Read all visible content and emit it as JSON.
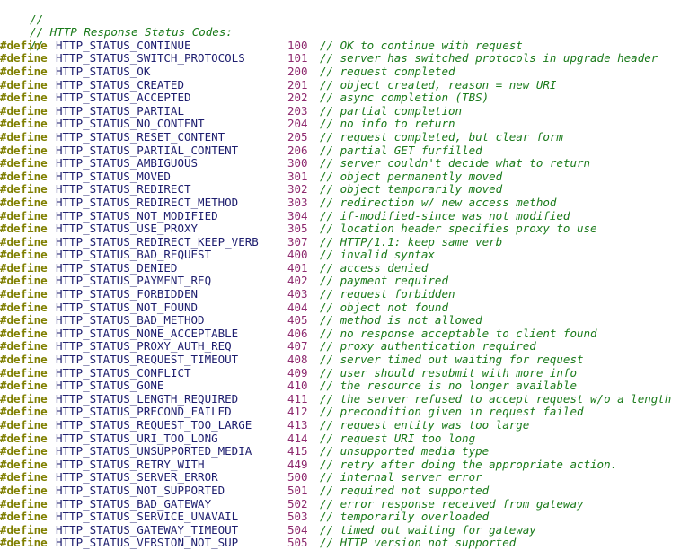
{
  "document": {
    "language": "c-header",
    "background_color": "#ffffff",
    "syntax_colors": {
      "comment": "#1a7a1a",
      "preprocessor_directive": "#7f7f00",
      "identifier": "#1d1d6e",
      "number": "#8e2a6e"
    },
    "directive_keyword": "#define",
    "comment_prefix": "//"
  },
  "header_comment": {
    "line1": "//",
    "line2": "// HTTP Response Status Codes:",
    "line3": "//"
  },
  "defines": [
    {
      "directive": "#define",
      "name": "HTTP_STATUS_CONTINUE",
      "value": "100",
      "comment": "// OK to continue with request"
    },
    {
      "directive": "#define",
      "name": "HTTP_STATUS_SWITCH_PROTOCOLS",
      "value": "101",
      "comment": "// server has switched protocols in upgrade header"
    },
    {
      "directive": "#define",
      "name": "HTTP_STATUS_OK",
      "value": "200",
      "comment": "// request completed"
    },
    {
      "directive": "#define",
      "name": "HTTP_STATUS_CREATED",
      "value": "201",
      "comment": "// object created, reason = new URI"
    },
    {
      "directive": "#define",
      "name": "HTTP_STATUS_ACCEPTED",
      "value": "202",
      "comment": "// async completion (TBS)"
    },
    {
      "directive": "#define",
      "name": "HTTP_STATUS_PARTIAL",
      "value": "203",
      "comment": "// partial completion"
    },
    {
      "directive": "#define",
      "name": "HTTP_STATUS_NO_CONTENT",
      "value": "204",
      "comment": "// no info to return"
    },
    {
      "directive": "#define",
      "name": "HTTP_STATUS_RESET_CONTENT",
      "value": "205",
      "comment": "// request completed, but clear form"
    },
    {
      "directive": "#define",
      "name": "HTTP_STATUS_PARTIAL_CONTENT",
      "value": "206",
      "comment": "// partial GET furfilled"
    },
    {
      "directive": "#define",
      "name": "HTTP_STATUS_AMBIGUOUS",
      "value": "300",
      "comment": "// server couldn't decide what to return"
    },
    {
      "directive": "#define",
      "name": "HTTP_STATUS_MOVED",
      "value": "301",
      "comment": "// object permanently moved"
    },
    {
      "directive": "#define",
      "name": "HTTP_STATUS_REDIRECT",
      "value": "302",
      "comment": "// object temporarily moved"
    },
    {
      "directive": "#define",
      "name": "HTTP_STATUS_REDIRECT_METHOD",
      "value": "303",
      "comment": "// redirection w/ new access method"
    },
    {
      "directive": "#define",
      "name": "HTTP_STATUS_NOT_MODIFIED",
      "value": "304",
      "comment": "// if-modified-since was not modified"
    },
    {
      "directive": "#define",
      "name": "HTTP_STATUS_USE_PROXY",
      "value": "305",
      "comment": "// location header specifies proxy to use"
    },
    {
      "directive": "#define",
      "name": "HTTP_STATUS_REDIRECT_KEEP_VERB",
      "value": "307",
      "comment": "// HTTP/1.1: keep same verb"
    },
    {
      "directive": "#define",
      "name": "HTTP_STATUS_BAD_REQUEST",
      "value": "400",
      "comment": "// invalid syntax"
    },
    {
      "directive": "#define",
      "name": "HTTP_STATUS_DENIED",
      "value": "401",
      "comment": "// access denied"
    },
    {
      "directive": "#define",
      "name": "HTTP_STATUS_PAYMENT_REQ",
      "value": "402",
      "comment": "// payment required"
    },
    {
      "directive": "#define",
      "name": "HTTP_STATUS_FORBIDDEN",
      "value": "403",
      "comment": "// request forbidden"
    },
    {
      "directive": "#define",
      "name": "HTTP_STATUS_NOT_FOUND",
      "value": "404",
      "comment": "// object not found"
    },
    {
      "directive": "#define",
      "name": "HTTP_STATUS_BAD_METHOD",
      "value": "405",
      "comment": "// method is not allowed"
    },
    {
      "directive": "#define",
      "name": "HTTP_STATUS_NONE_ACCEPTABLE",
      "value": "406",
      "comment": "// no response acceptable to client found"
    },
    {
      "directive": "#define",
      "name": "HTTP_STATUS_PROXY_AUTH_REQ",
      "value": "407",
      "comment": "// proxy authentication required"
    },
    {
      "directive": "#define",
      "name": "HTTP_STATUS_REQUEST_TIMEOUT",
      "value": "408",
      "comment": "// server timed out waiting for request"
    },
    {
      "directive": "#define",
      "name": "HTTP_STATUS_CONFLICT",
      "value": "409",
      "comment": "// user should resubmit with more info"
    },
    {
      "directive": "#define",
      "name": "HTTP_STATUS_GONE",
      "value": "410",
      "comment": "// the resource is no longer available"
    },
    {
      "directive": "#define",
      "name": "HTTP_STATUS_LENGTH_REQUIRED",
      "value": "411",
      "comment": "// the server refused to accept request w/o a length"
    },
    {
      "directive": "#define",
      "name": "HTTP_STATUS_PRECOND_FAILED",
      "value": "412",
      "comment": "// precondition given in request failed"
    },
    {
      "directive": "#define",
      "name": "HTTP_STATUS_REQUEST_TOO_LARGE",
      "value": "413",
      "comment": "// request entity was too large"
    },
    {
      "directive": "#define",
      "name": "HTTP_STATUS_URI_TOO_LONG",
      "value": "414",
      "comment": "// request URI too long"
    },
    {
      "directive": "#define",
      "name": "HTTP_STATUS_UNSUPPORTED_MEDIA",
      "value": "415",
      "comment": "// unsupported media type"
    },
    {
      "directive": "#define",
      "name": "HTTP_STATUS_RETRY_WITH",
      "value": "449",
      "comment": "// retry after doing the appropriate action."
    },
    {
      "directive": "#define",
      "name": "HTTP_STATUS_SERVER_ERROR",
      "value": "500",
      "comment": "// internal server error"
    },
    {
      "directive": "#define",
      "name": "HTTP_STATUS_NOT_SUPPORTED",
      "value": "501",
      "comment": "// required not supported"
    },
    {
      "directive": "#define",
      "name": "HTTP_STATUS_BAD_GATEWAY",
      "value": "502",
      "comment": "// error response received from gateway"
    },
    {
      "directive": "#define",
      "name": "HTTP_STATUS_SERVICE_UNAVAIL",
      "value": "503",
      "comment": "// temporarily overloaded"
    },
    {
      "directive": "#define",
      "name": "HTTP_STATUS_GATEWAY_TIMEOUT",
      "value": "504",
      "comment": "// timed out waiting for gateway"
    },
    {
      "directive": "#define",
      "name": "HTTP_STATUS_VERSION_NOT_SUP",
      "value": "505",
      "comment": "// HTTP version not supported"
    }
  ]
}
